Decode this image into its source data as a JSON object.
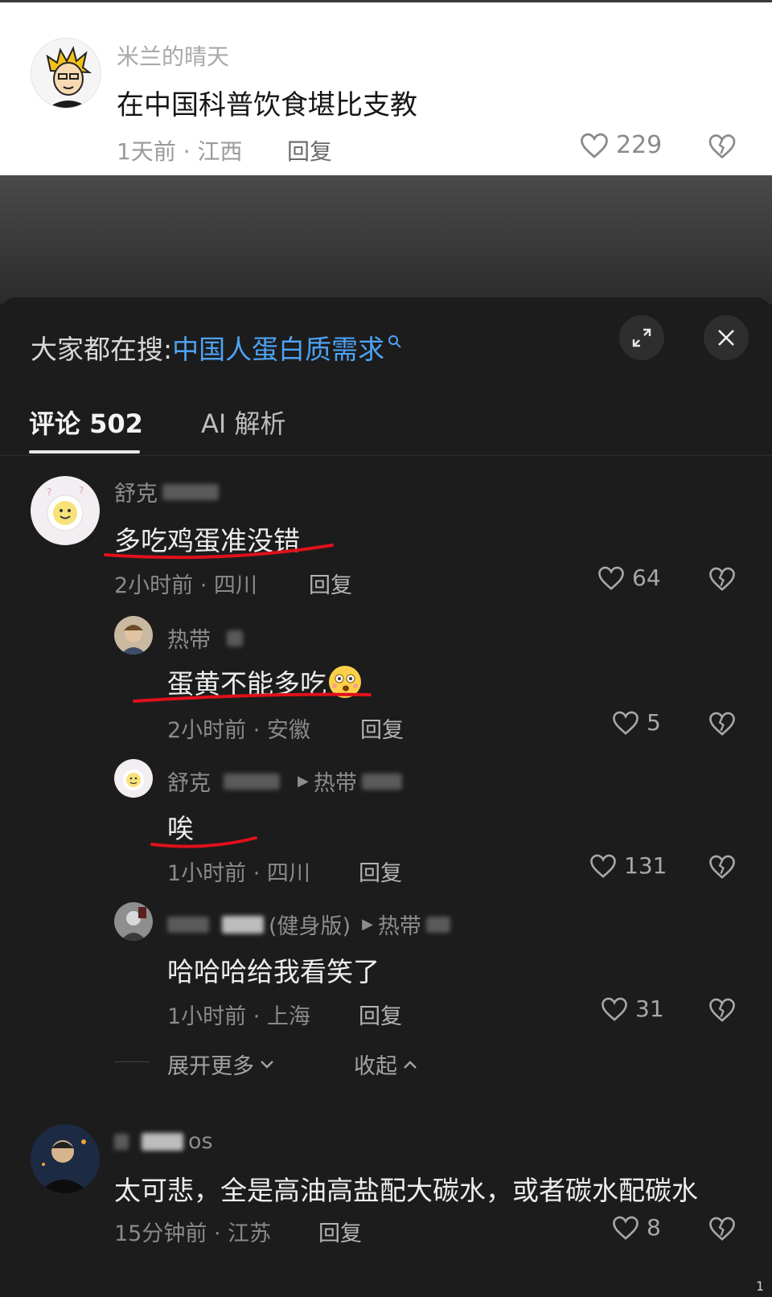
{
  "top_comment": {
    "username": "米兰的晴天",
    "text": "在中国科普饮食堪比支教",
    "meta": "1天前 · 江西",
    "reply_label": "回复",
    "likes": "229"
  },
  "sheet": {
    "search_prefix": "大家都在搜:",
    "search_term": "中国人蛋白质需求",
    "tabs": [
      {
        "label": "评论 502"
      },
      {
        "label": "AI 解析"
      }
    ]
  },
  "comments": [
    {
      "username": "舒克",
      "text": "多吃鸡蛋准没错",
      "meta": "2小时前 · 四川",
      "reply_label": "回复",
      "likes": "64"
    },
    {
      "username": "热带",
      "text": "蛋黄不能多吃",
      "meta": "2小时前 · 安徽",
      "reply_label": "回复",
      "likes": "5"
    },
    {
      "username": "舒克",
      "reply_to": "热带",
      "text": "唉",
      "meta": "1小时前 · 四川",
      "reply_label": "回复",
      "likes": "131"
    },
    {
      "username_suffix": "(健身版)",
      "reply_to": "热带",
      "text": "哈哈哈给我看笑了",
      "meta": "1小时前 · 上海",
      "reply_label": "回复",
      "likes": "31"
    },
    {
      "username": "os",
      "text": "太可悲，全是高油高盐配大碳水，或者碳水配碳水",
      "meta": "15分钟前 · 江苏",
      "reply_label": "回复",
      "likes": "8"
    }
  ],
  "expand": {
    "more_label": "展开更多",
    "collapse_label": "收起"
  },
  "page_number": "1",
  "colors": {
    "search_term": "#4da3f5",
    "underline": "#e0101a",
    "sheet_bg": "#1c1c1c"
  }
}
